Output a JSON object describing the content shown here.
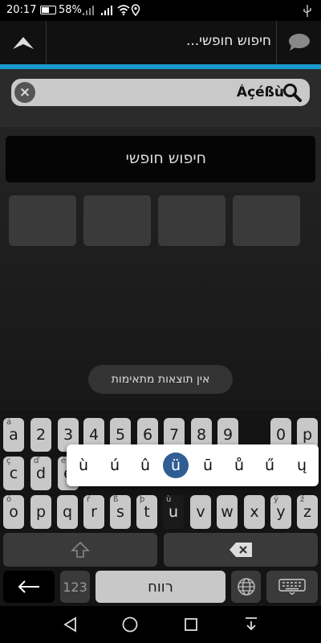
{
  "status_bar": {
    "time": "20:17",
    "battery_percent": "58%",
    "battery_level": 0.58
  },
  "action_bar": {
    "title": "חיפוש חופשי...",
    "up_icon": "up-arrow-icon",
    "chat_icon": "chat-bubble-icon"
  },
  "accent_color": "#1a9bd0",
  "search": {
    "value": "Áçéßù",
    "clear_icon": "clear-icon",
    "search_icon": "search-icon"
  },
  "free_search_label": "חיפוש חופשי",
  "no_results_toast": "אין תוצאות מתאימות",
  "keyboard": {
    "row1": [
      {
        "key": "a",
        "hint": "á"
      },
      {
        "key": "2",
        "hint": ""
      },
      {
        "key": "3",
        "hint": ""
      },
      {
        "key": "4",
        "hint": ""
      },
      {
        "key": "5",
        "hint": ""
      },
      {
        "key": "6",
        "hint": ""
      },
      {
        "key": "7",
        "hint": ""
      },
      {
        "key": "8",
        "hint": ""
      },
      {
        "key": "9",
        "hint": ""
      },
      {
        "key": "0",
        "hint": ""
      },
      {
        "key": "p",
        "hint": ""
      }
    ],
    "row2": [
      {
        "key": "c",
        "hint": "ç"
      },
      {
        "key": "d",
        "hint": "ď"
      },
      {
        "key": "e",
        "hint": "é"
      }
    ],
    "row3": [
      {
        "key": "o",
        "hint": "ó"
      },
      {
        "key": "p",
        "hint": ""
      },
      {
        "key": "q",
        "hint": ""
      },
      {
        "key": "r",
        "hint": "ŕ"
      },
      {
        "key": "s",
        "hint": "ß"
      },
      {
        "key": "t",
        "hint": "þ"
      },
      {
        "key": "u",
        "hint": "ù"
      },
      {
        "key": "v",
        "hint": ""
      },
      {
        "key": "w",
        "hint": ""
      },
      {
        "key": "x",
        "hint": ""
      },
      {
        "key": "y",
        "hint": "ý"
      },
      {
        "key": "z",
        "hint": "ź"
      }
    ],
    "accent_popup": [
      "ù",
      "ú",
      "û",
      "ü",
      "ū",
      "ů",
      "ű",
      "ų"
    ],
    "accent_selected": "ü",
    "shift_icon": "shift-arrow-icon",
    "backspace_icon": "backspace-icon",
    "enter_icon": "left-arrow-icon",
    "numbers_label": "123",
    "space_label": "רווח",
    "globe_icon": "globe-icon",
    "hide_keyboard_icon": "keyboard-icon"
  },
  "nav_bar": {
    "back_icon": "back-triangle-icon",
    "home_icon": "home-circle-icon",
    "recents_icon": "recents-square-icon",
    "notification_icon": "pull-down-icon"
  }
}
